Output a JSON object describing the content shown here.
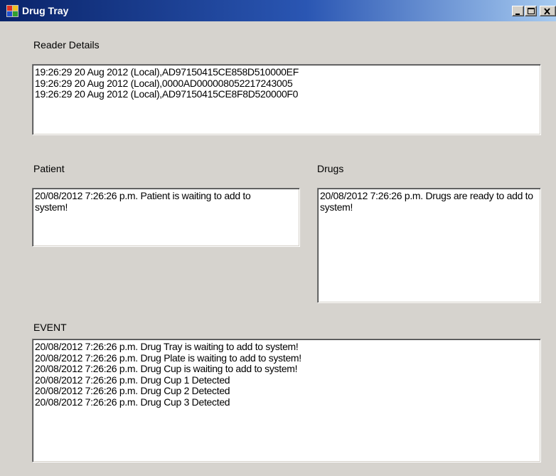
{
  "window": {
    "title": "Drug Tray"
  },
  "reader": {
    "label": "Reader Details",
    "lines": [
      "19:26:29 20 Aug 2012 (Local),AD97150415CE858D510000EF",
      "19:26:29 20 Aug 2012 (Local),0000AD000008052217243005",
      "19:26:29 20 Aug 2012 (Local),AD97150415CE8F8D520000F0"
    ]
  },
  "patient": {
    "label": "Patient",
    "text": "20/08/2012 7:26:26 p.m. Patient is waiting to add to system!"
  },
  "drugs": {
    "label": "Drugs",
    "text": "20/08/2012 7:26:26 p.m. Drugs are ready to add to system!"
  },
  "event": {
    "label": "EVENT",
    "lines": [
      "20/08/2012 7:26:26 p.m. Drug Tray is waiting to add to system!",
      "20/08/2012 7:26:26 p.m. Drug Plate is waiting to add to system!",
      "20/08/2012 7:26:26 p.m. Drug Cup is waiting to add to system!",
      "20/08/2012 7:26:26 p.m. Drug Cup 1 Detected",
      "20/08/2012 7:26:26 p.m. Drug Cup 2 Detected",
      "20/08/2012 7:26:26 p.m. Drug Cup 3 Detected"
    ]
  },
  "icons": {
    "app": "app-window-icon",
    "minimize": "minimize-icon",
    "maximize": "maximize-icon",
    "close": "close-icon"
  }
}
